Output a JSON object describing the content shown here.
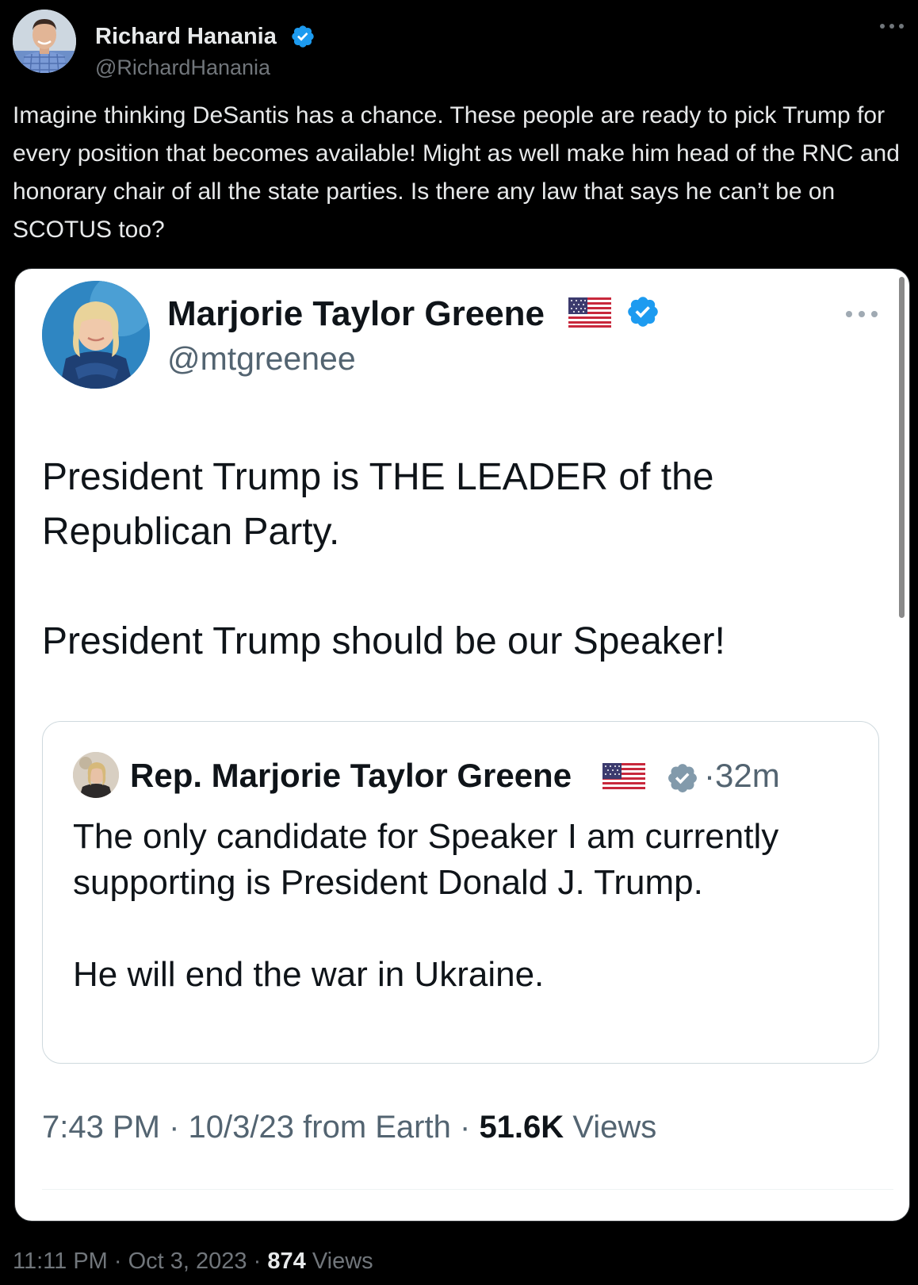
{
  "outer_tweet": {
    "author_name": "Richard Hanania",
    "author_handle": "@RichardHanania",
    "text": "Imagine thinking DeSantis has a chance. These people are ready to pick Trump for every position that becomes available! Might as well make him head of the RNC and honorary chair of all the state parties. Is there any law that says he can’t be on SCOTUS too?",
    "time": "11:11 PM",
    "date": "Oct 3, 2023",
    "views_count": "874",
    "views_label": "Views",
    "separator": "·"
  },
  "embedded_tweet": {
    "author_name": "Marjorie Taylor Greene",
    "author_handle": "@mtgreenee",
    "paragraphs": [
      "President Trump is THE LEADER of the Republican Party.",
      "President Trump should be our Speaker!"
    ],
    "time": "7:43 PM",
    "date": "10/3/23",
    "source": "from Earth",
    "views_count": "51.6K",
    "views_label": "Views",
    "separator": "·"
  },
  "quoted_tweet": {
    "author_name": "Rep. Marjorie Taylor Greene",
    "time_ago": "32m",
    "separator": "·",
    "paragraphs": [
      "The only candidate for Speaker I am currently supporting is President Donald J. Trump.",
      "He will end the war in Ukraine."
    ]
  },
  "icons": {
    "verified": "verified-badge-icon",
    "flag": "us-flag-icon",
    "more": "more-options-icon"
  },
  "colors": {
    "background": "#000000",
    "verified_blue": "#1d9bf0",
    "verified_gray": "#829aab",
    "card_background": "#ffffff"
  }
}
